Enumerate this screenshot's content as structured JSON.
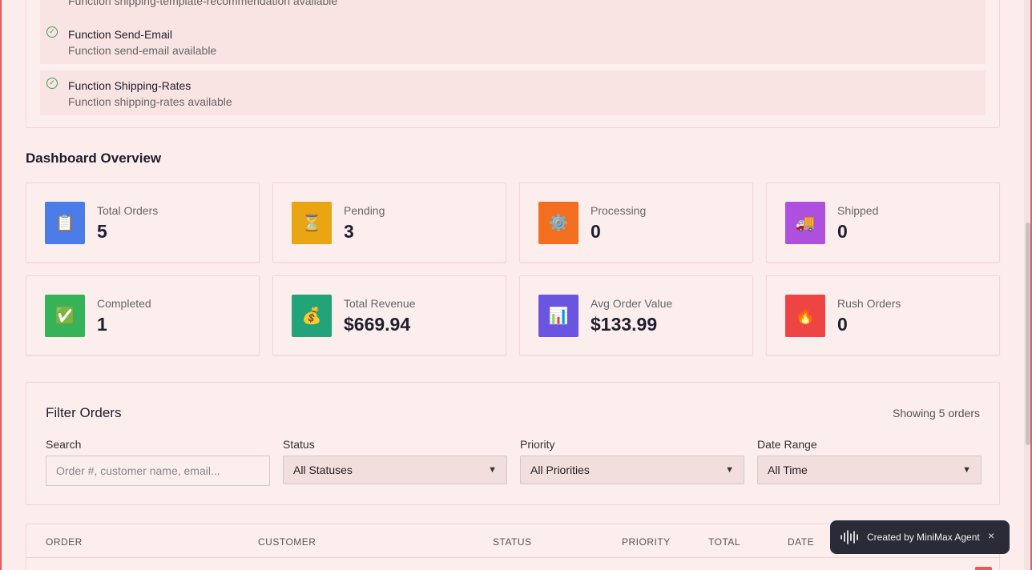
{
  "functions": [
    {
      "title": "",
      "desc": "Function shipping-template-recommendation available"
    },
    {
      "title": "Function Send-Email",
      "desc": "Function send-email available"
    },
    {
      "title": "Function Shipping-Rates",
      "desc": "Function shipping-rates available"
    }
  ],
  "dashboard": {
    "title": "Dashboard Overview",
    "stats": [
      {
        "label": "Total Orders",
        "value": "5",
        "icon": "clipboard-icon",
        "glyph": "📋",
        "color": "#4a7de8"
      },
      {
        "label": "Pending",
        "value": "3",
        "icon": "hourglass-icon",
        "glyph": "⏳",
        "color": "#eaa512"
      },
      {
        "label": "Processing",
        "value": "0",
        "icon": "gear-icon",
        "glyph": "⚙️",
        "color": "#f26f1f"
      },
      {
        "label": "Shipped",
        "value": "0",
        "icon": "truck-icon",
        "glyph": "🚚",
        "color": "#ae4fe0"
      },
      {
        "label": "Completed",
        "value": "1",
        "icon": "checkmark-icon",
        "glyph": "✅",
        "color": "#36b35a"
      },
      {
        "label": "Total Revenue",
        "value": "$669.94",
        "icon": "money-bag-icon",
        "glyph": "💰",
        "color": "#22a37a"
      },
      {
        "label": "Avg Order Value",
        "value": "$133.99",
        "icon": "bar-chart-icon",
        "glyph": "📊",
        "color": "#6a55e0"
      },
      {
        "label": "Rush Orders",
        "value": "0",
        "icon": "fire-icon",
        "glyph": "🔥",
        "color": "#ee4444"
      }
    ]
  },
  "filter": {
    "title": "Filter Orders",
    "showing": "Showing 5 orders",
    "search_label": "Search",
    "search_placeholder": "Order #, customer name, email...",
    "status_label": "Status",
    "status_value": "All Statuses",
    "priority_label": "Priority",
    "priority_value": "All Priorities",
    "date_label": "Date Range",
    "date_value": "All Time"
  },
  "table": {
    "headers": [
      "ORDER",
      "CUSTOMER",
      "STATUS",
      "PRIORITY",
      "TOTAL",
      "DATE"
    ]
  },
  "toast": {
    "label": "Created by MiniMax Agent",
    "close": "×"
  }
}
